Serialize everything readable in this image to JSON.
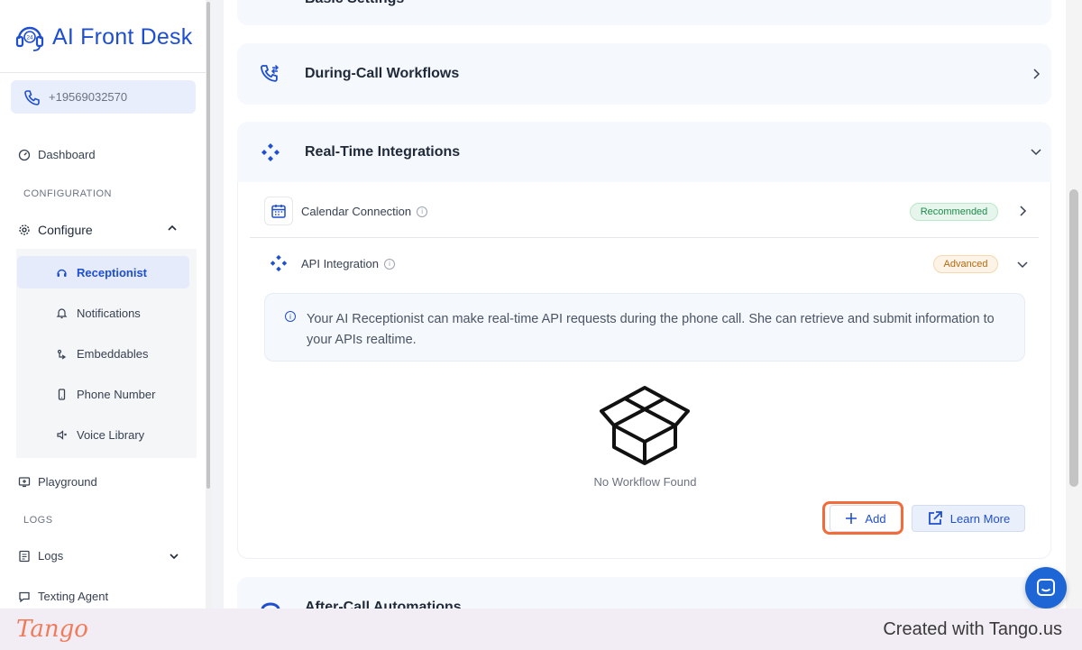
{
  "app": {
    "title": "AI Front Desk",
    "phone": "+19569032570",
    "brand_color": "#1f4fd1"
  },
  "sidebar": {
    "dashboard": "Dashboard",
    "configuration_label": "CONFIGURATION",
    "configure": "Configure",
    "submenu": [
      {
        "label": "Receptionist",
        "icon": "headset-icon",
        "active": true
      },
      {
        "label": "Notifications",
        "icon": "bell-icon"
      },
      {
        "label": "Embeddables",
        "icon": "embed-icon"
      },
      {
        "label": "Phone Number",
        "icon": "phone-device-icon"
      },
      {
        "label": "Voice Library",
        "icon": "speaker-icon"
      }
    ],
    "playground": "Playground",
    "logs_label": "LOGS",
    "logs": "Logs",
    "texting_agent": "Texting Agent"
  },
  "main": {
    "top_card_title": "Basic Settings",
    "during_call": "During-Call Workflows",
    "realtime": "Real-Time Integrations",
    "calendar": {
      "label": "Calendar Connection",
      "badge": "Recommended"
    },
    "api": {
      "label": "API Integration",
      "badge": "Advanced"
    },
    "info_text": "Your AI Receptionist can make real-time API requests during the phone call. She can retrieve and submit information to your APIs realtime.",
    "empty_text": "No Workflow Found",
    "add_button": "Add",
    "learn_more_button": "Learn More",
    "after_call": "After-Call Automations"
  },
  "footer": {
    "logo": "Tango",
    "created": "Created with Tango.us"
  }
}
